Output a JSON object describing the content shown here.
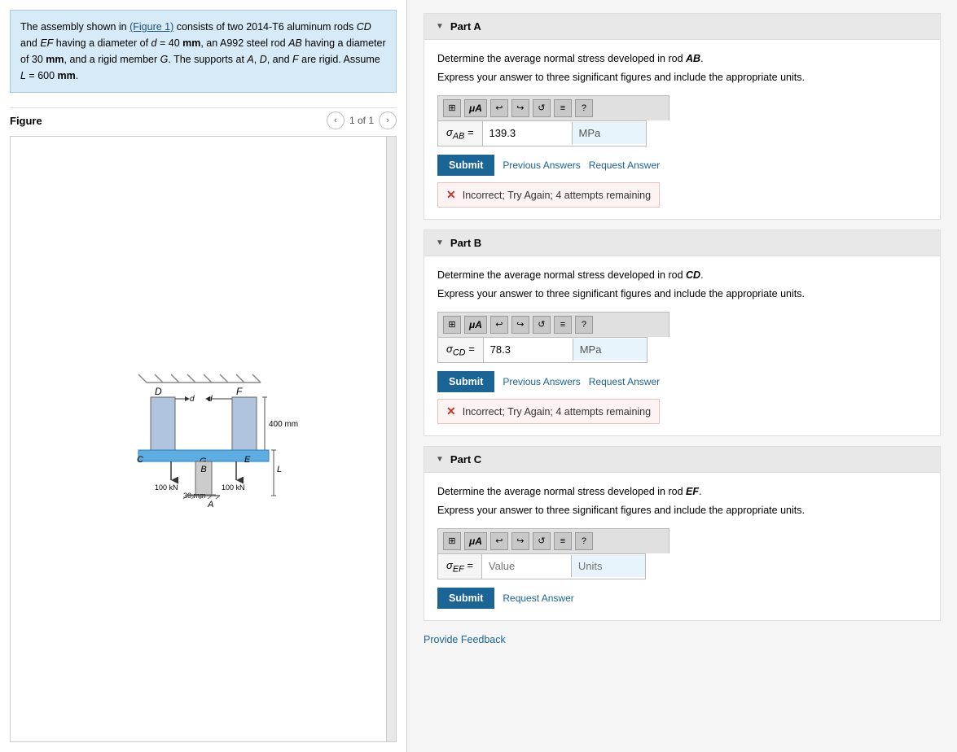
{
  "problem": {
    "text_before": "The assembly shown in ",
    "figure_link": "(Figure 1)",
    "text_after": " consists of two 2014-T6 aluminum rods ",
    "rods_cd_ef": "CD and EF",
    "text2": " having a diameter of ",
    "d_val": "d = 40 mm",
    "text3": ", an A992 steel rod ",
    "rod_ab": "AB",
    "text4": " having a diameter of 30 ",
    "mm1": "mm",
    "text5": ", and a rigid member ",
    "member_g": "G",
    "text6": ". The supports at ",
    "supports": "A, D,",
    "text7": " and ",
    "f_support": "F",
    "text8": " are rigid. Assume ",
    "l_val": "L = 600",
    "mm2": "mm",
    "text9": "."
  },
  "figure": {
    "title": "Figure",
    "nav_current": "1 of 1"
  },
  "parts": [
    {
      "id": "partA",
      "label": "Part A",
      "description_before": "Determine the average normal stress developed in rod ",
      "rod": "AB",
      "description_after": ".",
      "instruction": "Express your answer to three significant figures and include the appropriate units.",
      "equation_label": "σAB =",
      "value": "139.3",
      "units": "MPa",
      "submit_label": "Submit",
      "prev_answers_label": "Previous Answers",
      "request_answer_label": "Request Answer",
      "feedback_type": "incorrect",
      "feedback_text": "Incorrect; Try Again; 4 attempts remaining",
      "has_request_answer": false
    },
    {
      "id": "partB",
      "label": "Part B",
      "description_before": "Determine the average normal stress developed in rod ",
      "rod": "CD",
      "description_after": ".",
      "instruction": "Express your answer to three significant figures and include the appropriate units.",
      "equation_label": "σCD =",
      "value": "78.3",
      "units": "MPa",
      "submit_label": "Submit",
      "prev_answers_label": "Previous Answers",
      "request_answer_label": "Request Answer",
      "feedback_type": "incorrect",
      "feedback_text": "Incorrect; Try Again; 4 attempts remaining",
      "has_request_answer": false
    },
    {
      "id": "partC",
      "label": "Part C",
      "description_before": "Determine the average normal stress developed in rod ",
      "rod": "EF",
      "description_after": ".",
      "instruction": "Express your answer to three significant figures and include the appropriate units.",
      "equation_label": "σEF =",
      "value": "",
      "value_placeholder": "Value",
      "units": "",
      "units_placeholder": "Units",
      "submit_label": "Submit",
      "prev_answers_label": null,
      "request_answer_label": "Request Answer",
      "feedback_type": null,
      "feedback_text": null,
      "has_request_answer": true
    }
  ],
  "provide_feedback_label": "Provide Feedback",
  "toolbar": {
    "grid_icon": "⊞",
    "mu_icon": "μA",
    "undo_icon": "↩",
    "redo_icon": "↪",
    "reset_icon": "↺",
    "list_icon": "≡",
    "help_icon": "?"
  }
}
